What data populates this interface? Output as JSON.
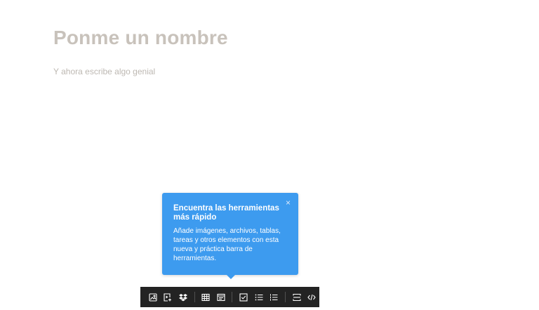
{
  "editor": {
    "title_placeholder": "Ponme un nombre",
    "body_placeholder": "Y ahora escribe algo genial"
  },
  "tooltip": {
    "close_symbol": "×",
    "title": "Encuentra las herramientas más rápido",
    "text": "Añade imágenes, archivos, tablas, tareas y otros elementos con esta nueva y práctica barra de herramientas."
  },
  "toolbar": {
    "accent_color": "#3d9bef",
    "groups": [
      [
        "image-icon",
        "video-file-icon",
        "dropbox-icon"
      ],
      [
        "table-icon",
        "calendar-icon"
      ],
      [
        "checkbox-icon",
        "bullet-list-icon",
        "numbered-list-icon"
      ],
      [
        "divider-icon",
        "code-icon"
      ]
    ]
  }
}
